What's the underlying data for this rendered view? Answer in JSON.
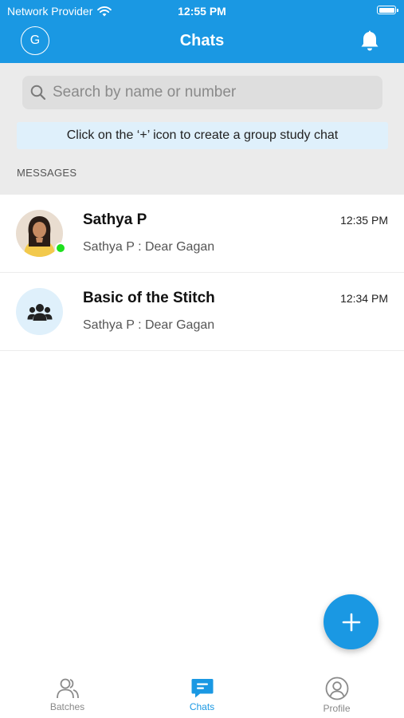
{
  "status_bar": {
    "carrier": "Network Provider",
    "time": "12:55 PM"
  },
  "header": {
    "avatar_initial": "G",
    "title": "Chats"
  },
  "search": {
    "placeholder": "Search by name or number",
    "value": ""
  },
  "hint": "Click on the ‘+’ icon to create a group study chat",
  "section_label": "MESSAGES",
  "chats": [
    {
      "name": "Sathya P",
      "preview": "Sathya P : Dear Gagan",
      "time": "12:35 PM",
      "online": true
    },
    {
      "name": "Basic of the Stitch",
      "preview": "Sathya P : Dear Gagan",
      "time": "12:34 PM",
      "online": false
    }
  ],
  "tabs": [
    {
      "label": "Batches",
      "icon": "batches-icon",
      "active": false
    },
    {
      "label": "Chats",
      "icon": "chats-icon",
      "active": true
    },
    {
      "label": "Profile",
      "icon": "profile-icon",
      "active": false
    }
  ],
  "colors": {
    "primary": "#1a98e3",
    "online": "#1ee01e",
    "hint_bg": "#dff0fb",
    "search_area_bg": "#ebebeb"
  }
}
